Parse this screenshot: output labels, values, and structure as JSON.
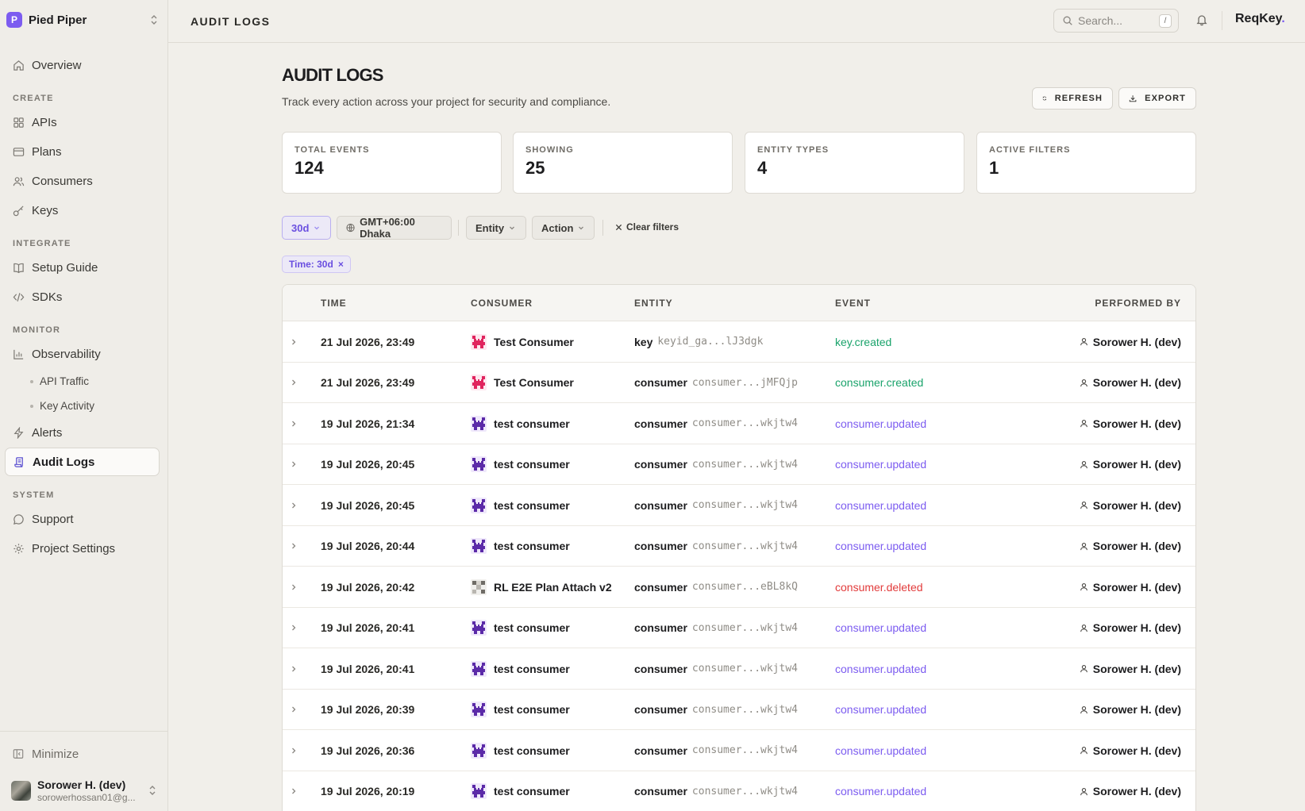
{
  "workspace": {
    "initial": "P",
    "name": "Pied Piper"
  },
  "sidebar": {
    "top_items": [
      {
        "label": "Overview",
        "icon": "home-icon"
      }
    ],
    "sections": {
      "create": {
        "label": "CREATE",
        "items": [
          "APIs",
          "Plans",
          "Consumers",
          "Keys"
        ]
      },
      "integrate": {
        "label": "INTEGRATE",
        "items": [
          "Setup Guide",
          "SDKs"
        ]
      },
      "monitor": {
        "label": "MONITOR",
        "items": [
          "Observability",
          "Alerts",
          "Audit Logs"
        ],
        "sub_items": [
          "API Traffic",
          "Key Activity"
        ]
      },
      "system": {
        "label": "SYSTEM",
        "items": [
          "Support",
          "Project Settings"
        ]
      }
    },
    "active_item": "Audit Logs",
    "minimize_label": "Minimize",
    "user": {
      "name": "Sorower H. (dev)",
      "email": "sorowerhossan01@g..."
    }
  },
  "topbar": {
    "title": "AUDIT LOGS",
    "search_placeholder": "Search...",
    "search_shortcut": "/",
    "brand": "ReqKey",
    "brand_dot": "."
  },
  "page": {
    "title": "AUDIT LOGS",
    "subtitle": "Track every action across your project for security and compliance.",
    "refresh_label": "REFRESH",
    "export_label": "EXPORT"
  },
  "stats": [
    {
      "label": "TOTAL EVENTS",
      "value": "124"
    },
    {
      "label": "SHOWING",
      "value": "25"
    },
    {
      "label": "ENTITY TYPES",
      "value": "4"
    },
    {
      "label": "ACTIVE FILTERS",
      "value": "1"
    }
  ],
  "filters": {
    "time": "30d",
    "timezone": "GMT+06:00 Dhaka",
    "entity": "Entity",
    "action": "Action",
    "clear": "Clear filters",
    "active_chip": "Time: 30d",
    "active_chip_remove": "×"
  },
  "table": {
    "columns": [
      "TIME",
      "CONSUMER",
      "ENTITY",
      "EVENT",
      "PERFORMED BY"
    ],
    "event_colors": {
      "key.created": "#1aa36b",
      "consumer.created": "#1aa36b",
      "consumer.updated": "#7c5cf0",
      "consumer.deleted": "#e23b3b"
    },
    "rows": [
      {
        "time": "21 Jul 2026, 23:49",
        "consumer": "Test Consumer",
        "avatar": "pink",
        "entity_type": "key",
        "entity_id": "keyid_ga...lJ3dgk",
        "event": "key.created",
        "by": "Sorower H. (dev)"
      },
      {
        "time": "21 Jul 2026, 23:49",
        "consumer": "Test Consumer",
        "avatar": "pink",
        "entity_type": "consumer",
        "entity_id": "consumer...jMFQjp",
        "event": "consumer.created",
        "by": "Sorower H. (dev)"
      },
      {
        "time": "19 Jul 2026, 21:34",
        "consumer": "test consumer",
        "avatar": "purple",
        "entity_type": "consumer",
        "entity_id": "consumer...wkjtw4",
        "event": "consumer.updated",
        "by": "Sorower H. (dev)"
      },
      {
        "time": "19 Jul 2026, 20:45",
        "consumer": "test consumer",
        "avatar": "purple",
        "entity_type": "consumer",
        "entity_id": "consumer...wkjtw4",
        "event": "consumer.updated",
        "by": "Sorower H. (dev)"
      },
      {
        "time": "19 Jul 2026, 20:45",
        "consumer": "test consumer",
        "avatar": "purple",
        "entity_type": "consumer",
        "entity_id": "consumer...wkjtw4",
        "event": "consumer.updated",
        "by": "Sorower H. (dev)"
      },
      {
        "time": "19 Jul 2026, 20:44",
        "consumer": "test consumer",
        "avatar": "purple",
        "entity_type": "consumer",
        "entity_id": "consumer...wkjtw4",
        "event": "consumer.updated",
        "by": "Sorower H. (dev)"
      },
      {
        "time": "19 Jul 2026, 20:42",
        "consumer": "RL E2E Plan Attach v2",
        "avatar": "gray",
        "entity_type": "consumer",
        "entity_id": "consumer...eBL8kQ",
        "event": "consumer.deleted",
        "by": "Sorower H. (dev)"
      },
      {
        "time": "19 Jul 2026, 20:41",
        "consumer": "test consumer",
        "avatar": "purple",
        "entity_type": "consumer",
        "entity_id": "consumer...wkjtw4",
        "event": "consumer.updated",
        "by": "Sorower H. (dev)"
      },
      {
        "time": "19 Jul 2026, 20:41",
        "consumer": "test consumer",
        "avatar": "purple",
        "entity_type": "consumer",
        "entity_id": "consumer...wkjtw4",
        "event": "consumer.updated",
        "by": "Sorower H. (dev)"
      },
      {
        "time": "19 Jul 2026, 20:39",
        "consumer": "test consumer",
        "avatar": "purple",
        "entity_type": "consumer",
        "entity_id": "consumer...wkjtw4",
        "event": "consumer.updated",
        "by": "Sorower H. (dev)"
      },
      {
        "time": "19 Jul 2026, 20:36",
        "consumer": "test consumer",
        "avatar": "purple",
        "entity_type": "consumer",
        "entity_id": "consumer...wkjtw4",
        "event": "consumer.updated",
        "by": "Sorower H. (dev)"
      },
      {
        "time": "19 Jul 2026, 20:19",
        "consumer": "test consumer",
        "avatar": "purple",
        "entity_type": "consumer",
        "entity_id": "consumer...wkjtw4",
        "event": "consumer.updated",
        "by": "Sorower H. (dev)"
      }
    ]
  }
}
